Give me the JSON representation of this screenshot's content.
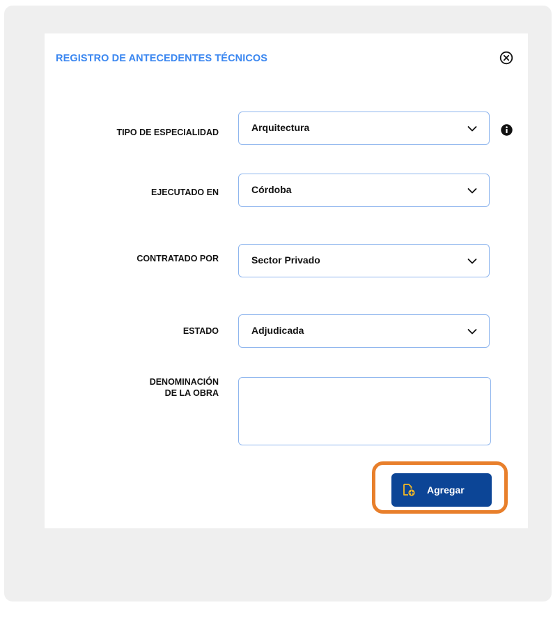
{
  "dialog": {
    "title": "REGISTRO DE ANTECEDENTES TÉCNICOS"
  },
  "fields": {
    "especialidad": {
      "label": "TIPO DE ESPECIALIDAD",
      "value": "Arquitectura"
    },
    "ejecutado": {
      "label": "EJECUTADO EN",
      "value": "Córdoba"
    },
    "contratado": {
      "label": "CONTRATADO POR",
      "value": "Sector Privado"
    },
    "estado": {
      "label": "ESTADO",
      "value": "Adjudicada"
    },
    "denominacion": {
      "label_line1": "DENOMINACIÓN",
      "label_line2": "DE LA OBRA",
      "value": ""
    }
  },
  "actions": {
    "add_label": "Agregar"
  },
  "icons": {
    "close": "close-circle-icon",
    "info": "info-icon",
    "dropdown": "chevron-down-icon",
    "add": "add-document-icon"
  },
  "colors": {
    "title": "#3b87f0",
    "button": "#0c4596",
    "highlight": "#e87f2b",
    "field_border": "#8fb6ee",
    "add_icon": "#f2b824"
  }
}
